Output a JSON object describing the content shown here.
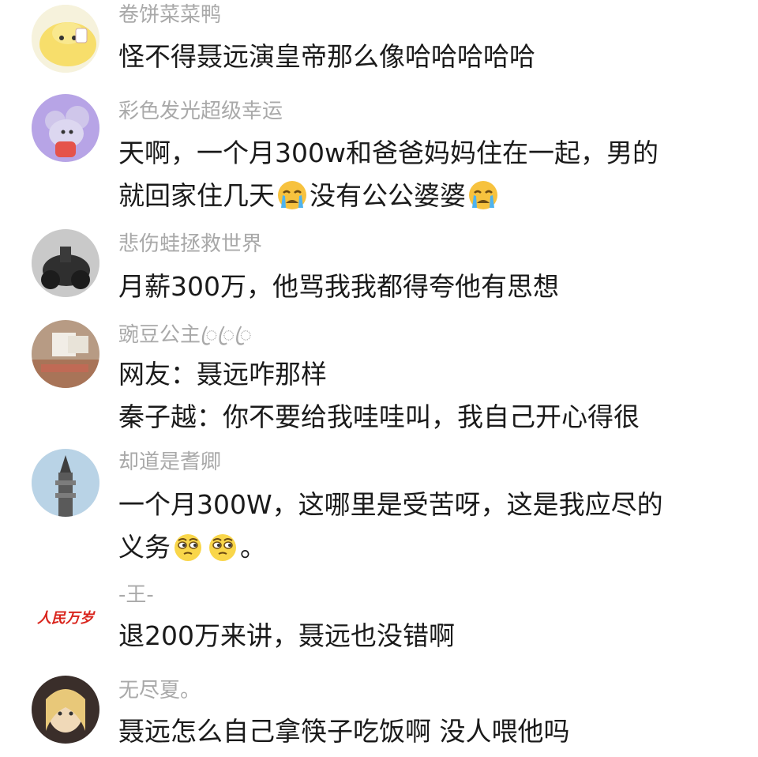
{
  "comments": [
    {
      "username": "卷饼菜菜鸭",
      "lines": [
        "怪不得聂远演皇帝那么像哈哈哈哈哈"
      ]
    },
    {
      "username": "彩色发光超级幸运",
      "line1": "天啊，一个月300w和爸爸妈妈住在一起，男的",
      "line2_a": "就回家住几天",
      "line2_b": "没有公公婆婆"
    },
    {
      "username": "悲伤蛙拯救世界",
      "lines": [
        "月薪300万，他骂我我都得夸他有思想"
      ]
    },
    {
      "username": "豌豆公主ꦿꦿꦿ",
      "lines": [
        "网友：聂远咋那样",
        "秦子越：你不要给我哇哇叫，我自己开心得很"
      ]
    },
    {
      "username": "却道是耆卿",
      "line1": "一个月300W，这哪里是受苦呀，这是我应尽的",
      "line2_a": "义务",
      "line2_b": "。"
    },
    {
      "username": "-王-",
      "avatar_text": "人民万岁",
      "lines": [
        "退200万来讲，聂远也没错啊"
      ]
    },
    {
      "username": "无尽夏。",
      "lines": [
        "聂远怎么自己拿筷子吃饭啊 没人喂他吗"
      ]
    }
  ],
  "emojis": {
    "comment2": [
      "crying-face",
      "crying-face"
    ],
    "comment5": [
      "thinking-eyes-face",
      "thinking-eyes-face"
    ]
  },
  "colors": {
    "username": "#a9a9a9",
    "text": "#1a1a1a",
    "background": "#ffffff"
  }
}
